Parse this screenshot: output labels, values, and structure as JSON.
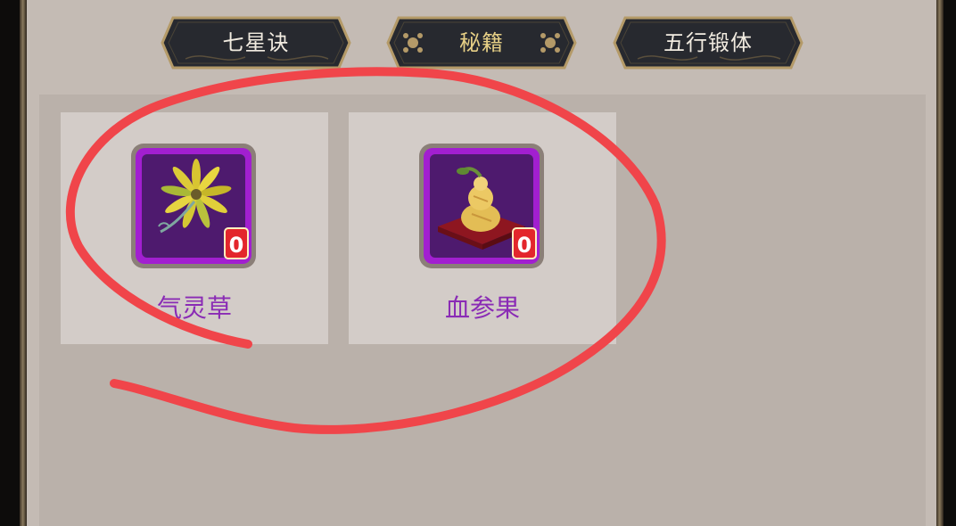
{
  "tabs": [
    {
      "label": "七星诀",
      "active": false
    },
    {
      "label": "秘籍",
      "active": true
    },
    {
      "label": "五行锻体",
      "active": false
    }
  ],
  "items": [
    {
      "name": "气灵草",
      "count": "0",
      "icon": "spirit-grass-icon"
    },
    {
      "name": "血参果",
      "count": "0",
      "icon": "blood-ginseng-fruit-icon"
    }
  ],
  "colors": {
    "panel": "#c4bbb4",
    "content": "#bab1aa",
    "card": "#d3ccc8",
    "item_name": "#8a2bb5",
    "tab_bg": "#27292f",
    "tab_border": "#b49a68",
    "tab_active_text": "#e6cf86",
    "icon_frame": "#a21fd0",
    "count_badge": "#e3262c",
    "annotation_stroke": "#f0454a"
  }
}
